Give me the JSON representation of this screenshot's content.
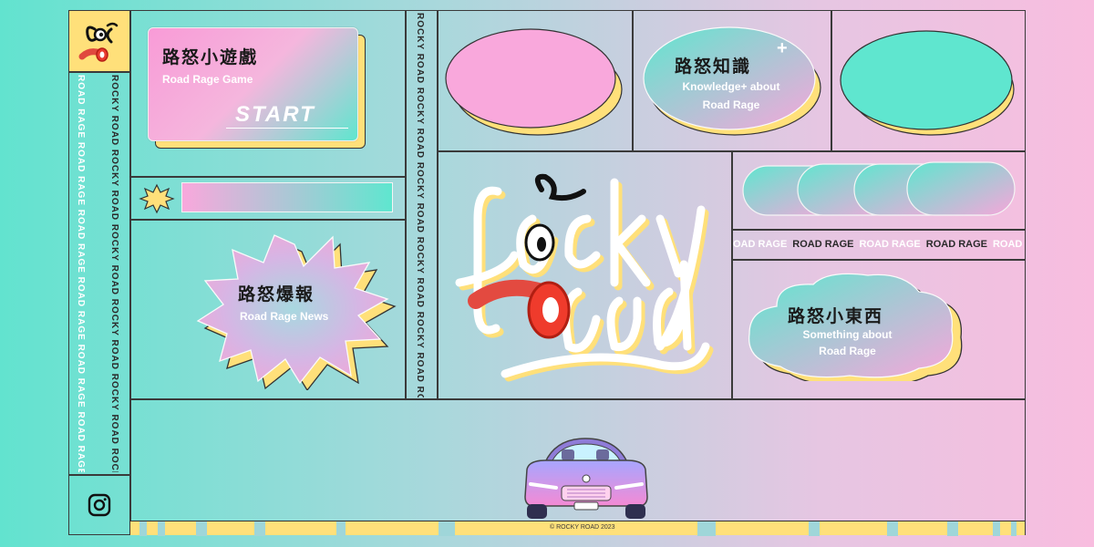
{
  "brand": {
    "logo_text": "Rocky Road",
    "vertical_text_a": "ROAD RAGE ROAD RAGE ROAD RAGE ROAD RAGE ROAD RAGE ROAD RAGE ROAD RAGE ROAD RAGE",
    "vertical_text_b": "ROCKY ROAD ROCKY ROAD ROCKY ROAD ROCKY ROAD ROCKY ROAD ROCKY ROAD ROCKY ROAD",
    "vertical_text_c": "ROCKY ROAD ROCKY ROAD ROCKY ROAD ROCKY ROAD ROCKY ROAD ROCKY ROAD"
  },
  "game_card": {
    "title": "路怒小遊戲",
    "subtitle": "Road Rage Game",
    "start_label": "START"
  },
  "news_card": {
    "title": "路怒爆報",
    "subtitle": "Road Rage News"
  },
  "knowledge_card": {
    "title": "路怒知識",
    "plus": "+",
    "subtitle_line1": "Knowledge+ about",
    "subtitle_line2": "Road Rage"
  },
  "things_card": {
    "title": "路怒小東西",
    "subtitle_line1": "Something about",
    "subtitle_line2": "Road Rage"
  },
  "ticker": {
    "items": [
      "OAD RAGE",
      "ROAD RAGE",
      "ROAD RAGE",
      "ROAD RAGE",
      "ROAD R"
    ]
  },
  "footer": {
    "copyright": "© ROCKY ROAD 2023"
  },
  "colors": {
    "pink": "#f9a8dc",
    "mint": "#5fe6cf",
    "yellow": "#ffe07a",
    "outline": "#3a3a3a"
  },
  "icons": {
    "instagram": "instagram-icon",
    "star": "star-burst-icon",
    "car": "car-icon"
  }
}
